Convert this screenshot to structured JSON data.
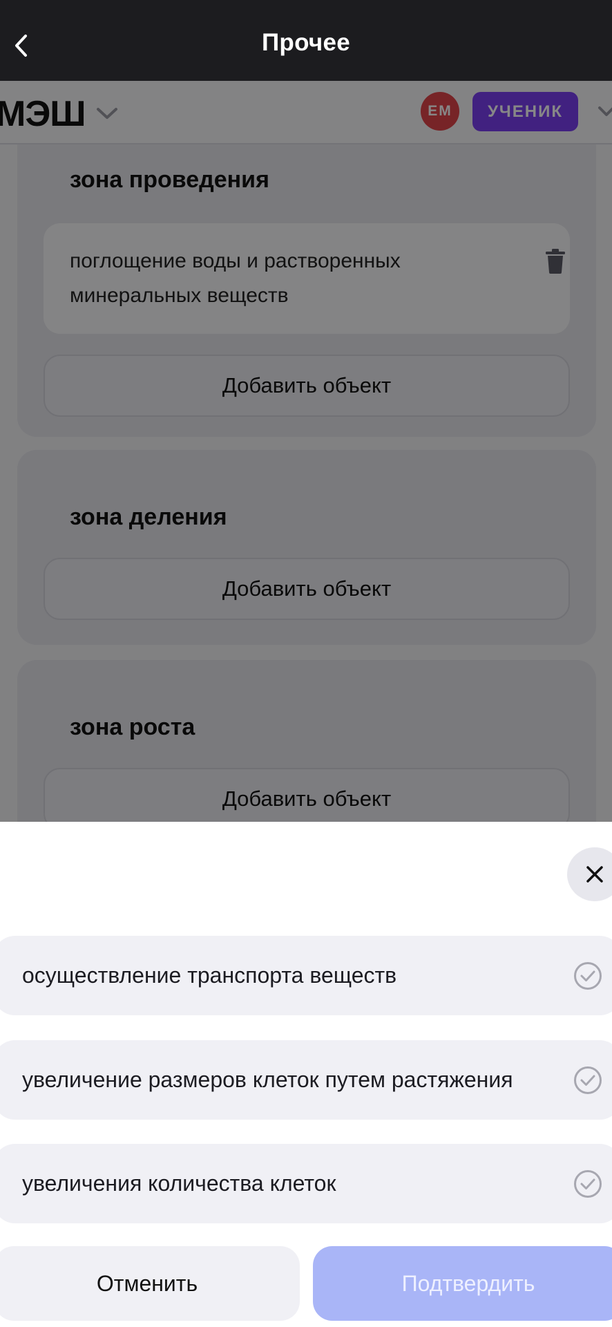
{
  "topbar": {
    "title": "Прочее"
  },
  "app_header": {
    "logo_text": "МЭШ",
    "avatar_initials": "ЕМ",
    "role_badge": "УЧЕНИК",
    "avatar_color": "#e0454a",
    "badge_color": "#7b3ff2"
  },
  "zones": [
    {
      "title": "зона проведения",
      "items": [
        "поглощение воды и растворенных минеральных веществ"
      ],
      "add_label": "Добавить объект"
    },
    {
      "title": "зона деления",
      "items": [],
      "add_label": "Добавить объект"
    },
    {
      "title": "зона роста",
      "items": [],
      "add_label": "Добавить объект"
    }
  ],
  "sheet": {
    "options": [
      "осуществление транспорта веществ",
      "увеличение размеров клеток путем растяжения",
      "увеличения количества клеток"
    ],
    "cancel_label": "Отменить",
    "confirm_label": "Подтвердить",
    "confirm_color": "#a9b5f7"
  }
}
